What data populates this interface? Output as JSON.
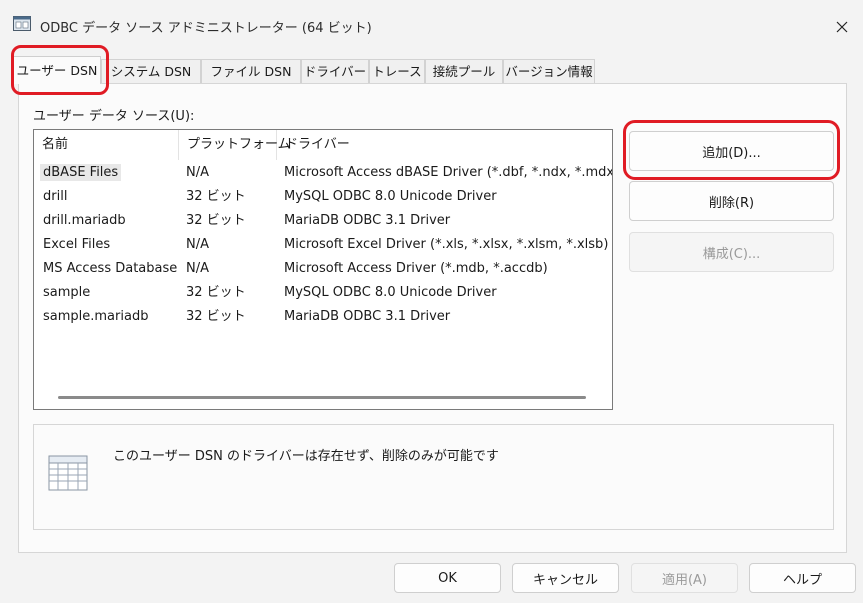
{
  "window": {
    "title": "ODBC データ ソース アドミニストレーター (64 ビット)",
    "close_label": "✕"
  },
  "tabs": [
    {
      "label": "ユーザー DSN",
      "active": true
    },
    {
      "label": "システム DSN",
      "active": false
    },
    {
      "label": "ファイル DSN",
      "active": false
    },
    {
      "label": "ドライバー",
      "active": false
    },
    {
      "label": "トレース",
      "active": false
    },
    {
      "label": "接続プール",
      "active": false
    },
    {
      "label": "バージョン情報",
      "active": false
    }
  ],
  "section_label": "ユーザー データ ソース(U):",
  "list": {
    "columns": [
      "名前",
      "プラットフォーム",
      "ドライバー"
    ],
    "rows": [
      {
        "name": "dBASE Files",
        "platform": "N/A",
        "driver": "Microsoft Access dBASE Driver (*.dbf, *.ndx, *.mdx)",
        "selected": true
      },
      {
        "name": "drill",
        "platform": "32 ビット",
        "driver": "MySQL ODBC 8.0 Unicode Driver",
        "selected": false
      },
      {
        "name": "drill.mariadb",
        "platform": "32 ビット",
        "driver": "MariaDB ODBC 3.1 Driver",
        "selected": false
      },
      {
        "name": "Excel Files",
        "platform": "N/A",
        "driver": "Microsoft Excel Driver (*.xls, *.xlsx, *.xlsm, *.xlsb)",
        "selected": false
      },
      {
        "name": "MS Access Database",
        "platform": "N/A",
        "driver": "Microsoft Access Driver (*.mdb, *.accdb)",
        "selected": false
      },
      {
        "name": "sample",
        "platform": "32 ビット",
        "driver": "MySQL ODBC 8.0 Unicode Driver",
        "selected": false
      },
      {
        "name": "sample.mariadb",
        "platform": "32 ビット",
        "driver": "MariaDB ODBC 3.1 Driver",
        "selected": false
      }
    ]
  },
  "side_buttons": {
    "add": "追加(D)...",
    "remove": "削除(R)",
    "configure": "構成(C)..."
  },
  "description": "このユーザー DSN のドライバーは存在せず、削除のみが可能です",
  "footer_buttons": {
    "ok": "OK",
    "cancel": "キャンセル",
    "apply": "適用(A)",
    "help": "ヘルプ"
  },
  "colors": {
    "highlight": "#e01b24",
    "window_bg": "#f3f3f3"
  }
}
